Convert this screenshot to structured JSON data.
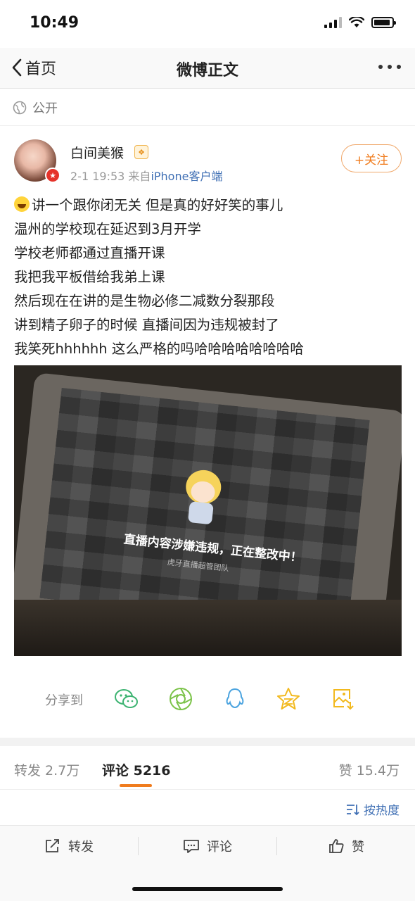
{
  "status_bar": {
    "time": "10:49"
  },
  "nav": {
    "back_label": "首页",
    "title": "微博正文"
  },
  "visibility": {
    "label": "公开"
  },
  "author": {
    "name": "白间美猴",
    "member_badge": "sid",
    "date": "2-1 19:53",
    "source_prefix": "来自",
    "source": "iPhone客户端",
    "follow_label": "+关注"
  },
  "post": {
    "lines": [
      "讲一个跟你闭无关 但是真的好好笑的事儿",
      "温州的学校现在延迟到3月开学",
      "学校老师都通过直播开课",
      "我把我平板借给我弟上课",
      "然后现在在讲的是生物必修二减数分裂那段",
      "讲到精子卵子的时候 直播间因为违规被封了",
      "我笑死hhhhhh 这么严格的吗哈哈哈哈哈哈哈哈"
    ],
    "image": {
      "screen_message": "直播内容涉嫌违规，正在整改中！",
      "screen_sub": "虎牙直播超管团队"
    }
  },
  "share": {
    "label": "分享到",
    "targets": [
      "wechat-icon",
      "moments-icon",
      "qq-icon",
      "qzone-icon",
      "save-image-icon"
    ]
  },
  "counts": {
    "repost": "转发 2.7万",
    "comment": "评论 5216",
    "like": "赞 15.4万"
  },
  "sort": {
    "label": "按热度"
  },
  "bottom_bar": {
    "repost": "转发",
    "comment": "评论",
    "like": "赞"
  },
  "colors": {
    "accent": "#f07c1e",
    "link": "#3f6fb4"
  }
}
